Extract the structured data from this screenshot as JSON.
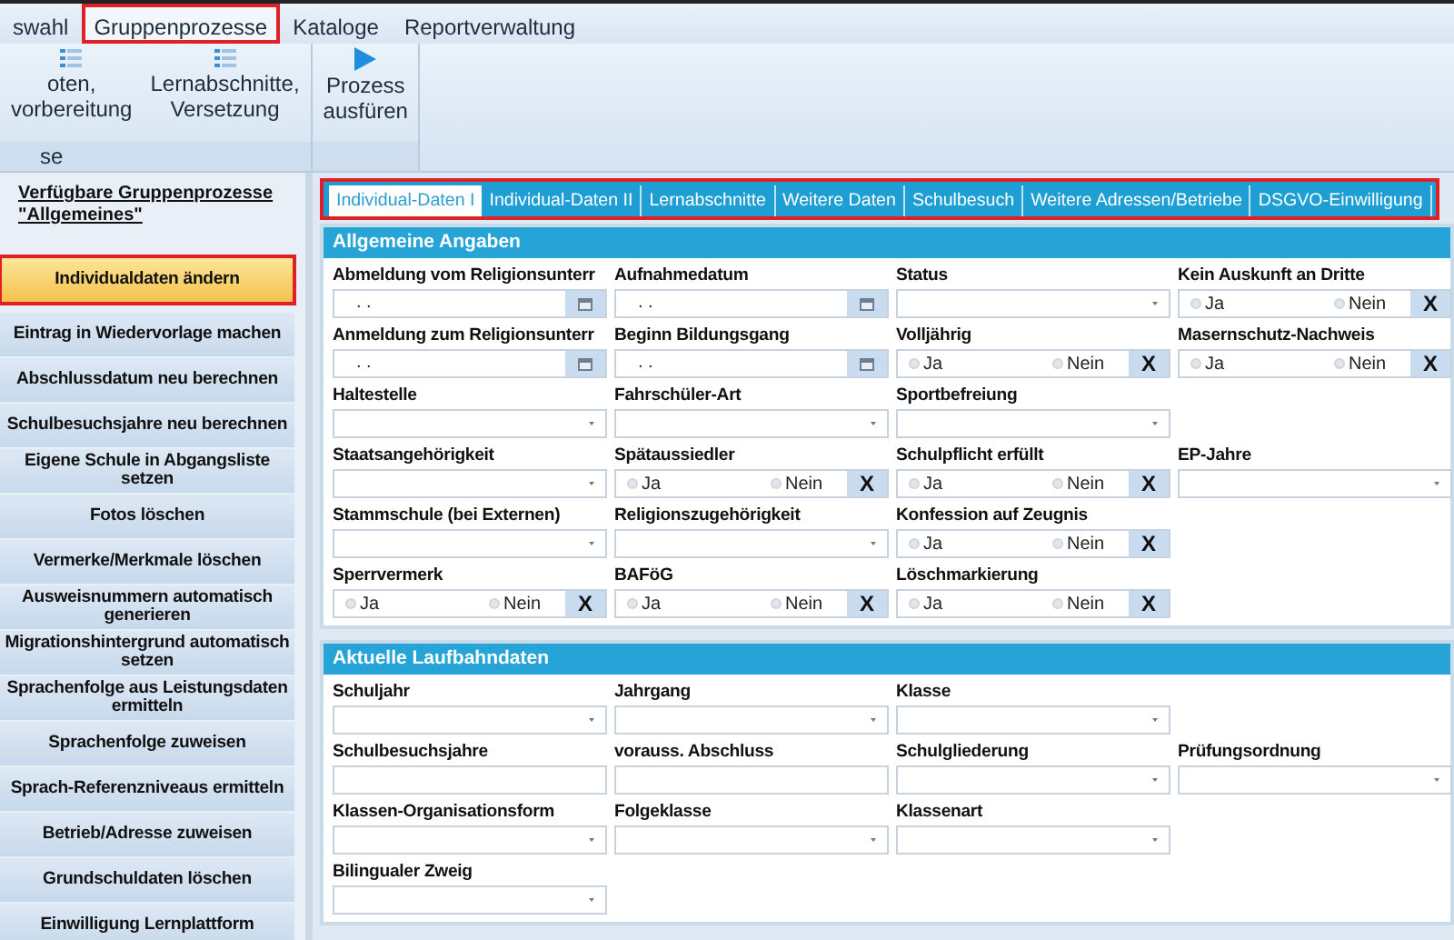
{
  "menu": [
    {
      "label": "swahl",
      "selected": false,
      "highlighted": false
    },
    {
      "label": "Gruppenprozesse",
      "selected": true,
      "highlighted": true
    },
    {
      "label": "Kataloge",
      "selected": false,
      "highlighted": false
    },
    {
      "label": "Reportverwaltung",
      "selected": false,
      "highlighted": false
    }
  ],
  "ribbon": {
    "groups": [
      {
        "label": "se",
        "buttons": [
          {
            "kind": "list",
            "lines": [
              "oten,",
              "vorbereitung"
            ]
          },
          {
            "kind": "list",
            "lines": [
              "Lernabschnitte,",
              "Versetzung"
            ]
          }
        ]
      },
      {
        "buttons": [
          {
            "kind": "play",
            "lines": [
              "Prozess",
              "ausfüren"
            ]
          }
        ]
      }
    ]
  },
  "sidebar": {
    "title": "Verfügbare Gruppenprozesse \"Allgemeines\"",
    "items": [
      {
        "label": "Individualdaten ändern",
        "selected": true,
        "highlighted": true
      },
      {
        "label": "Eintrag in Wiedervorlage machen",
        "selected": false,
        "highlighted": false
      },
      {
        "label": "Abschlussdatum neu berechnen",
        "selected": false,
        "highlighted": false
      },
      {
        "label": "Schulbesuchsjahre neu berechnen",
        "selected": false,
        "highlighted": false
      },
      {
        "label": "Eigene Schule in Abgangsliste setzen",
        "selected": false,
        "highlighted": false
      },
      {
        "label": "Fotos löschen",
        "selected": false,
        "highlighted": false
      },
      {
        "label": "Vermerke/Merkmale löschen",
        "selected": false,
        "highlighted": false
      },
      {
        "label": "Ausweisnummern automatisch generieren",
        "selected": false,
        "highlighted": false
      },
      {
        "label": "Migrationshintergrund automatisch setzen",
        "selected": false,
        "highlighted": false
      },
      {
        "label": "Sprachenfolge aus Leistungsdaten ermitteln",
        "selected": false,
        "highlighted": false
      },
      {
        "label": "Sprachenfolge zuweisen",
        "selected": false,
        "highlighted": false
      },
      {
        "label": "Sprach-Referenzniveaus ermitteln",
        "selected": false,
        "highlighted": false
      },
      {
        "label": "Betrieb/Adresse zuweisen",
        "selected": false,
        "highlighted": false
      },
      {
        "label": "Grundschuldaten löschen",
        "selected": false,
        "highlighted": false
      },
      {
        "label": "Einwilligung Lernplattform",
        "selected": false,
        "highlighted": false
      }
    ]
  },
  "tabs": {
    "highlighted": true,
    "items": [
      {
        "label": "Individual-Daten I",
        "selected": true
      },
      {
        "label": "Individual-Daten II",
        "selected": false
      },
      {
        "label": "Lernabschnitte",
        "selected": false
      },
      {
        "label": "Weitere Daten",
        "selected": false
      },
      {
        "label": "Schulbesuch",
        "selected": false
      },
      {
        "label": "Weitere Adressen/Betriebe",
        "selected": false
      },
      {
        "label": "DSGVO-Einwilligung",
        "selected": false
      }
    ]
  },
  "sections": [
    {
      "title": "Allgemeine Angaben",
      "rows": [
        [
          {
            "kind": "date",
            "label": "Abmeldung vom Religionsunterr",
            "value": ". ."
          },
          {
            "kind": "date",
            "label": "Aufnahmedatum",
            "value": ". ."
          },
          {
            "kind": "select",
            "label": "Status"
          },
          {
            "kind": "yesno",
            "label": "Kein Auskunft an Dritte",
            "options": [
              {
                "label": "Ja",
                "selected": false
              },
              {
                "label": "Nein",
                "selected": false
              }
            ],
            "clear": "X"
          }
        ],
        [
          {
            "kind": "date",
            "label": "Anmeldung zum Religionsunterr",
            "value": ". ."
          },
          {
            "kind": "date",
            "label": "Beginn Bildungsgang",
            "value": ". ."
          },
          {
            "kind": "yesno",
            "label": "Volljährig",
            "options": [
              {
                "label": "Ja",
                "selected": false
              },
              {
                "label": "Nein",
                "selected": false
              }
            ],
            "clear": "X"
          },
          {
            "kind": "yesno",
            "label": "Masernschutz-Nachweis",
            "options": [
              {
                "label": "Ja",
                "selected": false
              },
              {
                "label": "Nein",
                "selected": false
              }
            ],
            "clear": "X"
          }
        ],
        [
          {
            "kind": "select",
            "label": "Haltestelle"
          },
          {
            "kind": "select",
            "label": "Fahrschüler-Art"
          },
          {
            "kind": "select",
            "label": "Sportbefreiung"
          },
          null
        ],
        [
          {
            "kind": "select",
            "label": "Staatsangehörigkeit"
          },
          {
            "kind": "yesno",
            "label": "Spätaussiedler",
            "options": [
              {
                "label": "Ja",
                "selected": false
              },
              {
                "label": "Nein",
                "selected": false
              }
            ],
            "clear": "X"
          },
          {
            "kind": "yesno",
            "label": "Schulpflicht erfüllt",
            "options": [
              {
                "label": "Ja",
                "selected": false
              },
              {
                "label": "Nein",
                "selected": false
              }
            ],
            "clear": "X"
          },
          {
            "kind": "select",
            "label": "EP-Jahre"
          }
        ],
        [
          {
            "kind": "select",
            "label": "Stammschule (bei Externen)"
          },
          {
            "kind": "select",
            "label": "Religionszugehörigkeit"
          },
          {
            "kind": "yesno",
            "label": "Konfession auf Zeugnis",
            "options": [
              {
                "label": "Ja",
                "selected": false
              },
              {
                "label": "Nein",
                "selected": false
              }
            ],
            "clear": "X"
          },
          null
        ],
        [
          {
            "kind": "yesno",
            "label": "Sperrvermerk",
            "options": [
              {
                "label": "Ja",
                "selected": false
              },
              {
                "label": "Nein",
                "selected": false
              }
            ],
            "clear": "X"
          },
          {
            "kind": "yesno",
            "label": "BAFöG",
            "options": [
              {
                "label": "Ja",
                "selected": false
              },
              {
                "label": "Nein",
                "selected": false
              }
            ],
            "clear": "X"
          },
          {
            "kind": "yesno",
            "label": "Löschmarkierung",
            "options": [
              {
                "label": "Ja",
                "selected": false
              },
              {
                "label": "Nein",
                "selected": false
              }
            ],
            "clear": "X"
          },
          null
        ]
      ]
    },
    {
      "title": "Aktuelle Laufbahndaten",
      "rows": [
        [
          {
            "kind": "select",
            "label": "Schuljahr"
          },
          {
            "kind": "select",
            "label": "Jahrgang"
          },
          {
            "kind": "select",
            "label": "Klasse"
          },
          null
        ],
        [
          {
            "kind": "text",
            "label": "Schulbesuchsjahre"
          },
          {
            "kind": "text",
            "label": "vorauss. Abschluss"
          },
          {
            "kind": "select",
            "label": "Schulgliederung"
          },
          {
            "kind": "select",
            "label": "Prüfungsordnung"
          }
        ],
        [
          {
            "kind": "select",
            "label": "Klassen-Organisationsform"
          },
          {
            "kind": "select",
            "label": "Folgeklasse"
          },
          {
            "kind": "select",
            "label": "Klassenart"
          },
          null
        ],
        [
          {
            "kind": "select",
            "label": "Bilingualer Zweig"
          },
          null,
          null,
          null
        ]
      ]
    }
  ]
}
